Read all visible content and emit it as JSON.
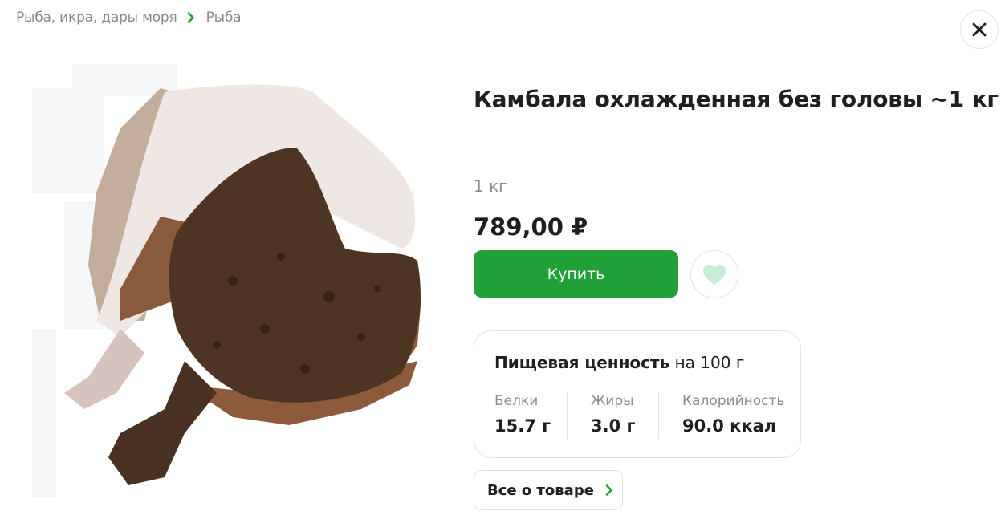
{
  "breadcrumbs": [
    {
      "label": "Рыба, икра, дары моря"
    },
    {
      "label": "Рыба"
    }
  ],
  "product": {
    "title": "Камбала охлажденная без головы ~1 кг",
    "weight": "1 кг",
    "price": "789,00 ₽",
    "buy_label": "Купить"
  },
  "nutrition": {
    "title_bold": "Пищевая ценность",
    "title_rest": " на 100 г",
    "items": [
      {
        "label": "Белки",
        "value": "15.7 г"
      },
      {
        "label": "Жиры",
        "value": "3.0 г"
      },
      {
        "label": "Калорийность",
        "value": "90.0 ккал"
      }
    ]
  },
  "more_label": "Все о товаре",
  "colors": {
    "accent": "#21a038",
    "heart": "#c9ecd6",
    "muted_text": "#8c8c8c",
    "border": "#e3e3e3"
  },
  "icons": {
    "breadcrumb_separator": "chevron-right-icon",
    "close": "close-icon",
    "favorite": "heart-icon",
    "more": "chevron-right-icon"
  }
}
